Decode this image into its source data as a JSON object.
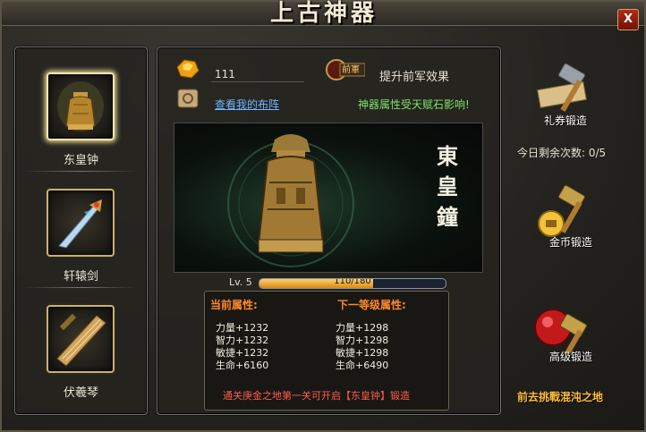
{
  "window": {
    "title": "上古神器",
    "close_label": "X"
  },
  "artifacts": [
    {
      "name": "东皇钟",
      "selected": true
    },
    {
      "name": "轩辕剑",
      "selected": false
    },
    {
      "name": "伏羲琴",
      "selected": false
    }
  ],
  "resources": {
    "stone_count": "111",
    "upgrade_label": "提升前军效果",
    "badge_text": "前軍",
    "formation_link": "查看我的布阵",
    "talent_note": "神器属性受天赋石影响!"
  },
  "display": {
    "calligraphy": [
      "東",
      "皇",
      "鐘"
    ]
  },
  "level": {
    "label": "Lv. 5",
    "exp_text": "110/180",
    "exp_fraction": 0.611
  },
  "stats": {
    "current_header": "当前属性:",
    "next_header": "下一等级属性:",
    "current": [
      "力量+1232",
      "智力+1232",
      "敏捷+1232",
      "生命+6160"
    ],
    "next": [
      "力量+1298",
      "智力+1298",
      "敏捷+1298",
      "生命+6490"
    ],
    "hint": "通关庚金之地第一关可开启【东皇钟】锻造"
  },
  "forge": {
    "voucher_label": "礼券锻造",
    "remaining_label": "今日剩余次数: 0/5",
    "gold_label": "金币锻造",
    "advanced_label": "高级锻造"
  },
  "footer": {
    "challenge_link": "前去挑戰混沌之地"
  },
  "colors": {
    "accent_gold": "#ffbf3a",
    "exp_fill": "#f0a832",
    "hint_red": "#ff5d4b",
    "talent_green": "#7ee26b"
  }
}
